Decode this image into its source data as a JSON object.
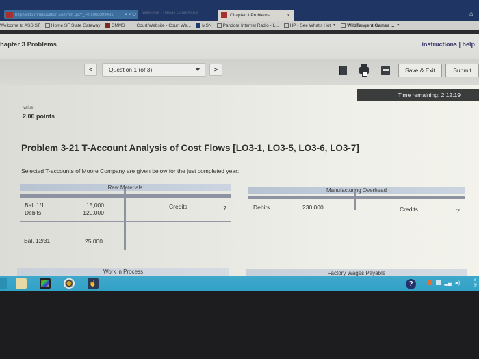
{
  "browser": {
    "address_url": "http://ezto.mheducation.com/hm.tpx?_=0.1068399481",
    "inactive_tab": "Welcome - Hawaii Court Assist",
    "active_tab": "Chapter 3 Problems",
    "tab_close": "×",
    "favorites": [
      {
        "label": "Welcome to ASSIST"
      },
      {
        "label": "Home  SF State Gateway"
      },
      {
        "label": "CMMS"
      },
      {
        "label": "Court Website - Court We..."
      },
      {
        "label": "MSN"
      },
      {
        "label": "Pandora Internet Radio - L..."
      },
      {
        "label": "HP - See What's Hot",
        "dropdown": true
      },
      {
        "label": "WildTangent Games ...",
        "dropdown": true
      }
    ]
  },
  "header": {
    "chapter_title": "hapter 3 Problems",
    "instructions_link": "instructions",
    "separator": " | ",
    "help_link": "help"
  },
  "toolbar": {
    "prev_label": "<",
    "next_label": ">",
    "question_select": "Question 1 (of 3)",
    "save_exit_label": "Save & Exit",
    "submit_label": "Submit"
  },
  "timer": {
    "label": "Time remaining:",
    "value": "2:12:19"
  },
  "question": {
    "value_label": "value:",
    "points": "2.00 points",
    "title": "Problem 3-21 T-Account Analysis of Cost Flows [LO3-1, LO3-5, LO3-6, LO3-7]",
    "intro": "Selected T-accounts of Moore Company are given below for the just completed year:"
  },
  "t_accounts": {
    "raw_materials": {
      "title": "Raw Materials",
      "debit_rows": [
        {
          "label": "Bal. 1/1",
          "amount": "15,000"
        },
        {
          "label": "Debits",
          "amount": "120,000"
        }
      ],
      "credit_label": "Credits",
      "credit_amount": "?",
      "ending_label": "Bal. 12/31",
      "ending_amount": "25,000"
    },
    "manufacturing_overhead": {
      "title": "Manufacturing Overhead",
      "debit_label": "Debits",
      "debit_amount": "230,000",
      "credit_label": "Credits",
      "credit_amount": "?"
    },
    "work_in_process": {
      "title": "Work in Process"
    },
    "factory_wages_payable": {
      "title": "Factory Wages Payable"
    }
  },
  "taskbar": {
    "help_icon": "?",
    "clock_partial": "8\n6/"
  }
}
